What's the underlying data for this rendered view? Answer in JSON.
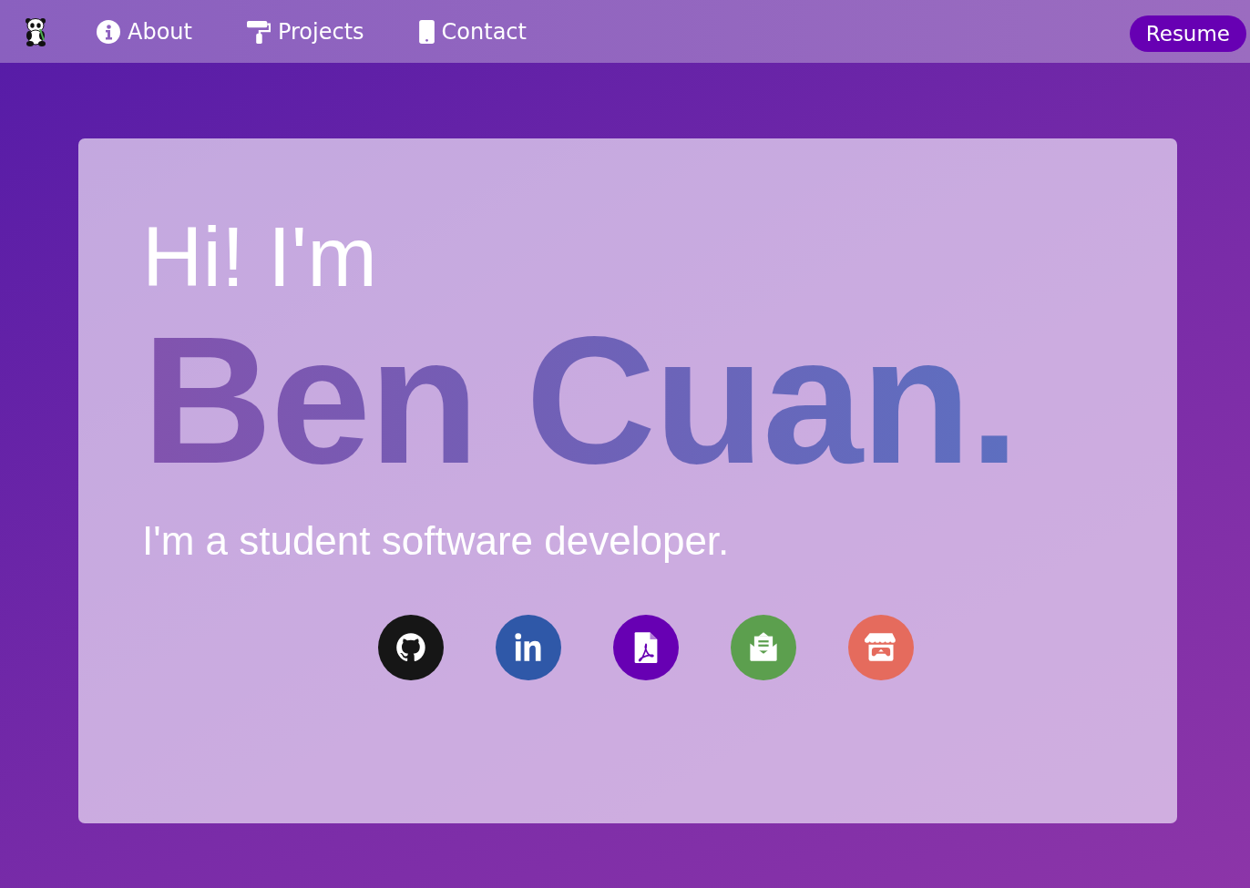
{
  "nav": {
    "items": [
      {
        "label": "About",
        "kind": "info"
      },
      {
        "label": "Projects",
        "kind": "roller"
      },
      {
        "label": "Contact",
        "kind": "phone"
      }
    ],
    "resume_button": "Resume"
  },
  "hero": {
    "greeting": "Hi! I'm",
    "name": "Ben Cuan.",
    "tagline": "I'm a student software developer.",
    "social_links": [
      {
        "kind": "github",
        "color": "#161616"
      },
      {
        "kind": "linkedin",
        "color": "#2f58a8"
      },
      {
        "kind": "pdf",
        "color": "#6700b3"
      },
      {
        "kind": "mail",
        "color": "#5c9f4e"
      },
      {
        "kind": "store",
        "color": "#e56b5d"
      }
    ]
  }
}
